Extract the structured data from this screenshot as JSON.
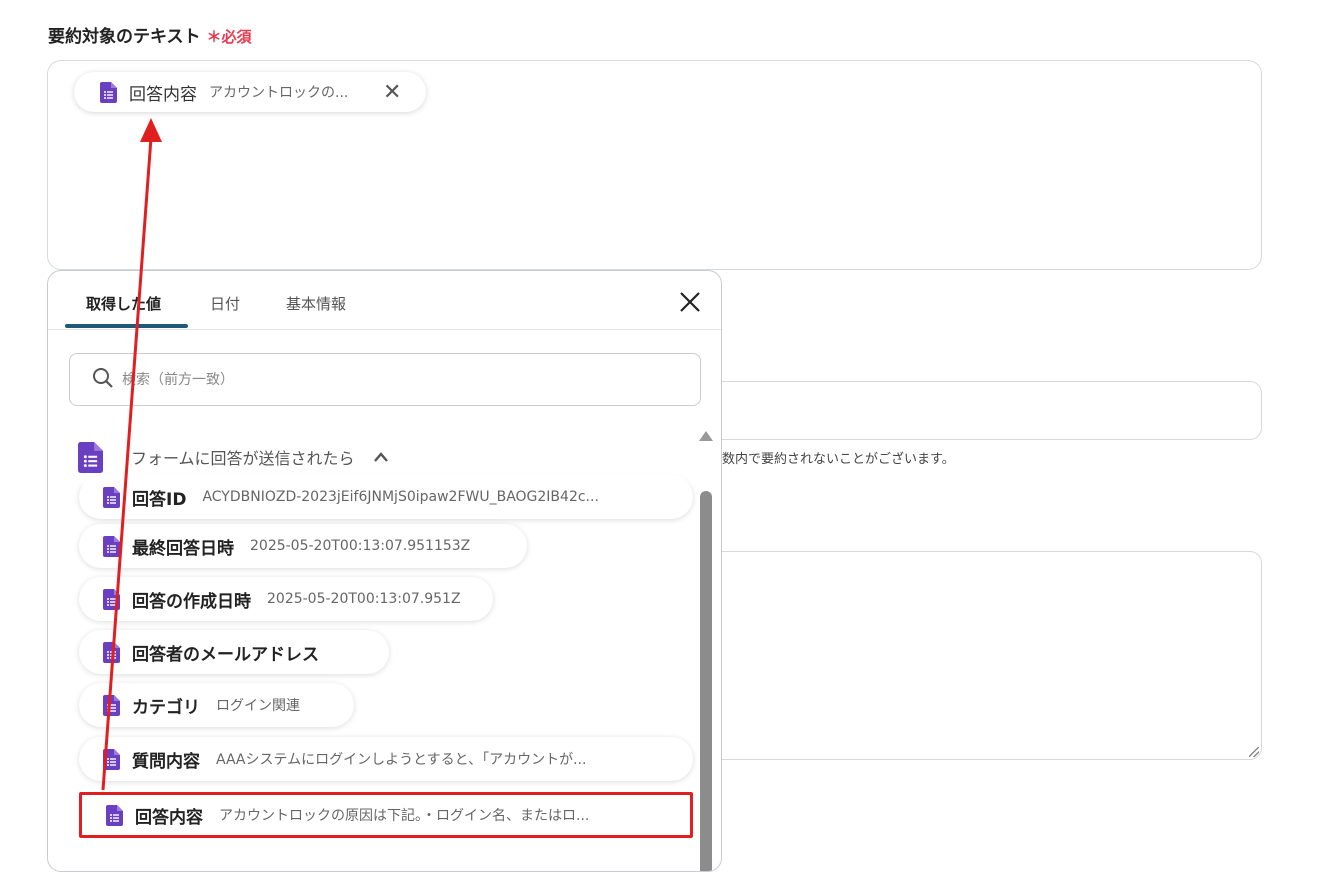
{
  "field": {
    "label": "要約対象のテキスト",
    "required_mark": "＊",
    "required_text": "必須"
  },
  "chip": {
    "title": "回答内容",
    "value": "アカウントロックの..."
  },
  "background": {
    "hint": "数内で要約されないことがございます。"
  },
  "panel": {
    "tabs": [
      {
        "label": "取得した値"
      },
      {
        "label": "日付"
      },
      {
        "label": "基本情報"
      }
    ],
    "close_icon": "×",
    "search": {
      "placeholder": "検索（前方一致）"
    },
    "group": {
      "title": "フォームに回答が送信されたら"
    },
    "items": [
      {
        "title": "回答ID",
        "value": "ACYDBNIOZD-2023jEif6JNMjS0ipaw2FWU_BAOG2IB42c..."
      },
      {
        "title": "最終回答日時",
        "value": "2025-05-20T00:13:07.951153Z"
      },
      {
        "title": "回答の作成日時",
        "value": "2025-05-20T00:13:07.951Z"
      },
      {
        "title": "回答者のメールアドレス",
        "value": ""
      },
      {
        "title": "カテゴリ",
        "value": "ログイン関連"
      },
      {
        "title": "質問内容",
        "value": "AAAシステムにログインしようとすると、「アカウントが..."
      },
      {
        "title": "回答内容",
        "value": "アカウントロックの原因は下記。・ログイン名、またはロ..."
      }
    ]
  },
  "colors": {
    "accent": "#1f5b78",
    "required": "#e8394d",
    "doc_icon": "#6a3fc1",
    "annotation": "#e02020"
  }
}
